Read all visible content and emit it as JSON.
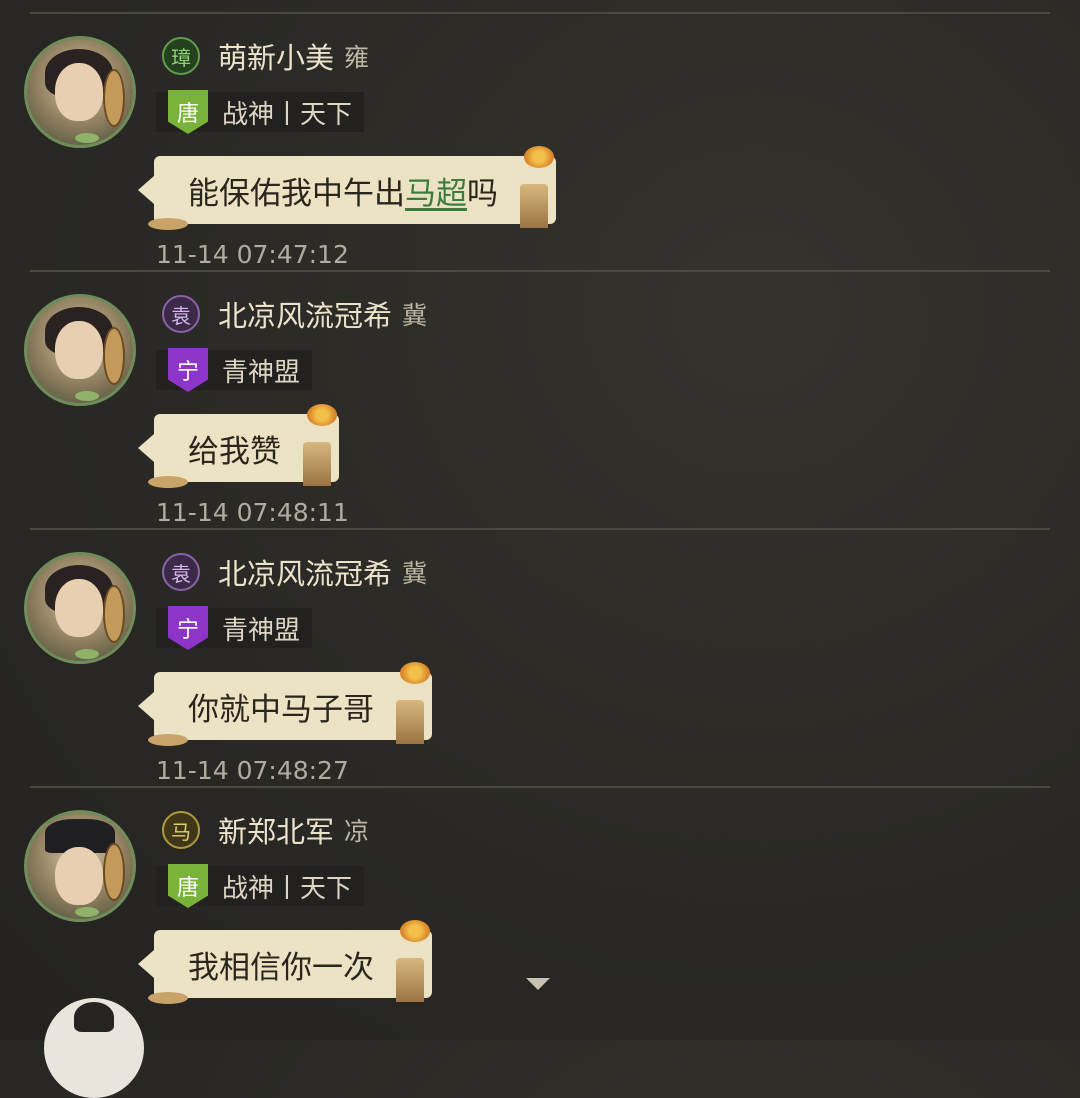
{
  "messages": [
    {
      "state": "璋",
      "state_color": "#5e9e4b",
      "name": "萌新小美",
      "region": "雍",
      "guild_badge": "唐",
      "guild_color": "#7ab33a",
      "guild": "战神丨天下",
      "text_before": "能保佑我中午出",
      "keyword": "马超",
      "text_after": "吗",
      "time": "11-14 07:47:12",
      "avatar_icon": "female-lute-avatar"
    },
    {
      "state": "袁",
      "state_color": "#8a63a6",
      "name": "北凉风流冠希",
      "region": "冀",
      "guild_badge": "宁",
      "guild_color": "#8e35c9",
      "guild": "青神盟",
      "text": "给我赞",
      "time": "11-14 07:48:11",
      "avatar_icon": "male-swordsman-avatar"
    },
    {
      "state": "袁",
      "state_color": "#8a63a6",
      "name": "北凉风流冠希",
      "region": "冀",
      "guild_badge": "宁",
      "guild_color": "#8e35c9",
      "guild": "青神盟",
      "text": "你就中马子哥",
      "time": "11-14 07:48:27",
      "avatar_icon": "male-swordsman-avatar"
    },
    {
      "state": "马",
      "state_color": "#b09a3e",
      "name": "新郑北军",
      "region": "凉",
      "guild_badge": "唐",
      "guild_color": "#7ab33a",
      "guild": "战神丨天下",
      "text": "我相信你一次",
      "avatar_icon": "official-hat-avatar"
    }
  ],
  "scroll_indicator_icon": "chevron-down-icon"
}
